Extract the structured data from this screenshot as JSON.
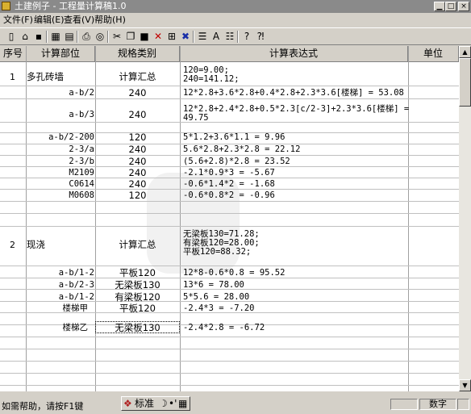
{
  "window": {
    "title": "土建例子 - 工程量计算稿1.0"
  },
  "menu": [
    "文件(F)",
    "编辑(E)",
    "查看(V)",
    "帮助(H)"
  ],
  "toolbar": {
    "buttons": [
      "new-icon",
      "open-icon",
      "save-icon",
      "calc-icon",
      "export-icon",
      "print-icon",
      "preview-icon",
      "cut-icon",
      "copy-icon",
      "lock-icon",
      "delete-icon",
      "insert-row-icon",
      "delete-row-icon",
      "indent-icon",
      "font-icon",
      "format-icon",
      "help-icon",
      "context-help-icon"
    ]
  },
  "table": {
    "headers": [
      "序号",
      "计算部位",
      "规格类别",
      "计算表达式",
      "单位"
    ],
    "rows": [
      {
        "seq": "1",
        "part": "多孔砖墙",
        "spec": "计算汇总",
        "expr": "120=9.00;\n240=141.12;"
      },
      {
        "seq": "",
        "part": "a-b/2",
        "spec": "240",
        "expr": "12*2.8+3.6*2.8+0.4*2.8+2.3*3.6[楼梯] = 53.08"
      },
      {
        "seq": "",
        "part": "a-b/3",
        "spec": "240",
        "expr": "12*2.8+2.4*2.8+0.5*2.3[c/2-3]+2.3*3.6[楼梯] =\n49.75"
      },
      {
        "seq": "",
        "part": "a-b/2-200",
        "spec": "120",
        "expr": "5*1.2+3.6*1.1 = 9.96"
      },
      {
        "seq": "",
        "part": "2-3/a",
        "spec": "240",
        "expr": "5.6*2.8+2.3*2.8 = 22.12"
      },
      {
        "seq": "",
        "part": "2-3/b",
        "spec": "240",
        "expr": "(5.6+2.8)*2.8 = 23.52"
      },
      {
        "seq": "",
        "part": "M2109",
        "spec": "240",
        "expr": "-2.1*0.9*3 = -5.67"
      },
      {
        "seq": "",
        "part": "C0614",
        "spec": "240",
        "expr": "-0.6*1.4*2 = -1.68"
      },
      {
        "seq": "",
        "part": "M0608",
        "spec": "120",
        "expr": "-0.6*0.8*2 = -0.96"
      },
      {
        "seq": "2",
        "part": "现浇",
        "spec": "计算汇总",
        "expr": "无梁板130=71.28;\n有梁板120=28.00;\n平板120=88.32;"
      },
      {
        "seq": "",
        "part": "a-b/1-2",
        "spec": "平板120",
        "expr": "12*8-0.6*0.8 = 95.52"
      },
      {
        "seq": "",
        "part": "a-b/2-3",
        "spec": "无梁板130",
        "expr": "13*6 = 78.00"
      },
      {
        "seq": "",
        "part": "a-b/1-2",
        "spec": "有梁板120",
        "expr": "5*5.6 = 28.00"
      },
      {
        "seq": "",
        "part": "楼梯甲",
        "spec": "平板120",
        "expr": "-2.4*3 = -7.20"
      },
      {
        "seq": "",
        "part": "楼梯乙",
        "spec": "无梁板130",
        "expr": "-2.4*2.8 = -6.72"
      }
    ]
  },
  "status": {
    "help_text": "如需帮助，请按F1键",
    "ime_label": "标准",
    "ime_mode": "•'",
    "num_indicator": "数字"
  }
}
